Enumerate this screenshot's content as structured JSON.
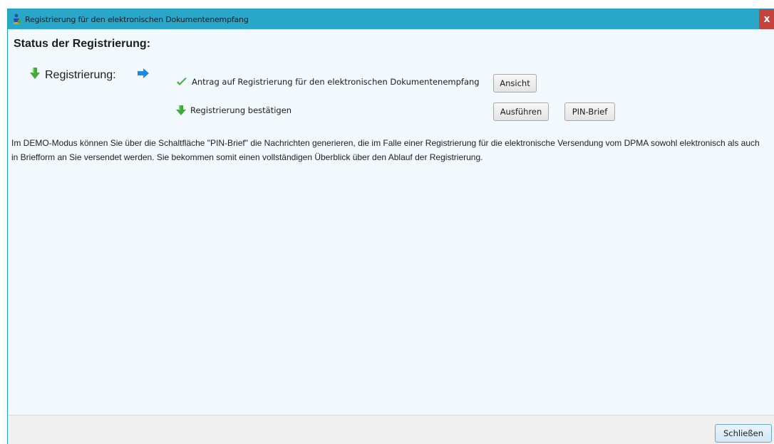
{
  "window": {
    "title": "Registrierung für den elektronischen Dokumentenempfang",
    "close_glyph": "x",
    "title_icon": "app-person-icon"
  },
  "status": {
    "heading": "Status der Registrierung:",
    "registration_label": "Registrierung:",
    "steps": [
      {
        "label": "Antrag auf Registrierung für den elektronischen Dokumentenempfang",
        "icon": "checkmark-icon"
      },
      {
        "label": "Registrierung bestätigen",
        "icon": "down-arrow-icon"
      }
    ],
    "buttons": {
      "view": "Ansicht",
      "execute": "Ausführen",
      "pin_letter": "PIN-Brief"
    }
  },
  "info_text": "Im DEMO-Modus können Sie über die Schaltfläche \"PIN-Brief\" die Nachrichten generieren, die im Falle einer Registrierung für die elektronische Versendung vom DPMA sowohl elektronisch als auch in Briefform an Sie versendet werden. Sie bekommen somit einen vollständigen Überblick über den Ablauf der Registrierung.",
  "footer": {
    "close_button": "Schließen"
  },
  "colors": {
    "titlebar": "#2aa6c9",
    "close": "#c8423c",
    "arrow_green": "#3fa93a",
    "arrow_blue": "#1e88e5",
    "check_green": "#4caf50"
  }
}
